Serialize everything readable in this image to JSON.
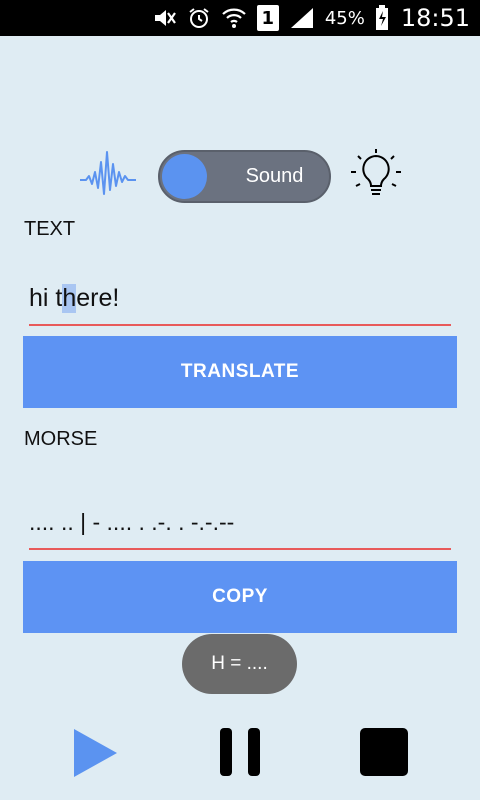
{
  "status_bar": {
    "sim_slot": "1",
    "battery_percent": "45%",
    "time": "18:51"
  },
  "toggle": {
    "label": "Sound"
  },
  "text_section": {
    "label": "TEXT",
    "value_before_selection": "hi t",
    "value_selected": "h",
    "value_after_selection": "ere!"
  },
  "translate_button": {
    "label": "TRANSLATE"
  },
  "morse_section": {
    "label": "MORSE",
    "value": ".... .. | - .... . .-. . -.-.--"
  },
  "copy_button": {
    "label": "COPY"
  },
  "toast": {
    "text": "H = ...."
  },
  "colors": {
    "background": "#dfecf3",
    "accent": "#5d93f3",
    "underline": "#e85a5a",
    "toggle_track": "#6b7280"
  },
  "icons": {
    "wave": "sound-wave-icon",
    "bulb": "light-bulb-icon",
    "play": "play-icon",
    "pause": "pause-icon",
    "stop": "stop-icon"
  }
}
